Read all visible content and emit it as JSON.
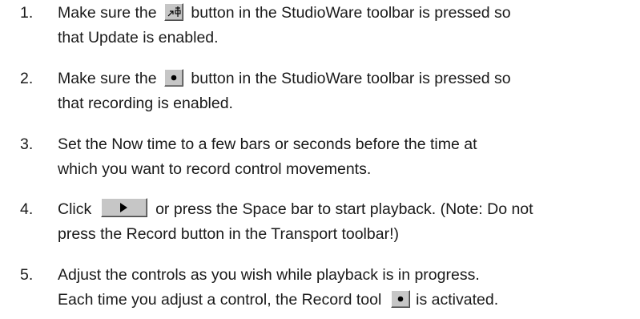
{
  "steps": [
    {
      "number": "1.",
      "line1_before": "Make sure the",
      "line1_after": "button in the StudioWare toolbar is pressed so",
      "line2": "that Update is enabled.",
      "icon": "update-icon"
    },
    {
      "number": "2.",
      "line1_before": "Make sure the",
      "line1_after": "button in the StudioWare toolbar is pressed so",
      "line2": "that recording is enabled.",
      "icon": "record-icon"
    },
    {
      "number": "3.",
      "line1": "Set the Now time to a few bars or seconds before the time at",
      "line2": "which you want to record control movements."
    },
    {
      "number": "4.",
      "line1_before": "Click",
      "line1_after": "or press the Space bar to start playback. (Note: Do not",
      "line2": "press the Record button in the Transport toolbar!)",
      "icon": "play-icon"
    },
    {
      "number": "5.",
      "line1": "Adjust the controls as you wish while playback is in progress.",
      "line2_before": "Each time you adjust a control, the Record tool",
      "line2_after": "is activated.",
      "icon": "record-icon"
    }
  ]
}
